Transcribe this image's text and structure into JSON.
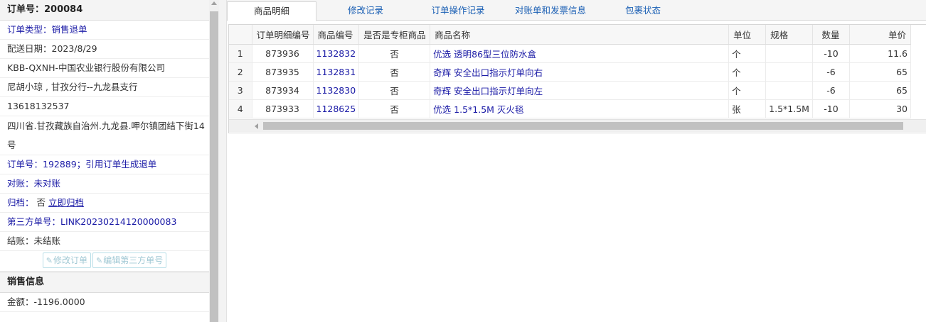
{
  "order": {
    "header": "订单号：200084",
    "fields": [
      {
        "text": "订单类型：销售退单",
        "style": "blue"
      },
      {
        "text": "配送日期：2023/8/29",
        "style": "dark"
      },
      {
        "text": "KBB-QXNH-中国农业银行股份有限公司",
        "style": "dark"
      },
      {
        "text": "尼胡小琼 , 甘孜分行--九龙县支行",
        "style": "dark"
      },
      {
        "text": "13618132537",
        "style": "dark"
      }
    ],
    "address": "四川省.甘孜藏族自治州.九龙县.呷尔镇团结下街14号",
    "ref_order": "订单号：192889；引用订单生成退单",
    "reconcile": "对账：未对账",
    "archive_label": "归档：",
    "archive_value": "否",
    "archive_link": "立即归档",
    "third_party": "第三方单号：LINK20230214120000083",
    "settlement": "结账：未结账",
    "buttons": {
      "edit_order": "修改订单",
      "edit_third_party": "编辑第三方单号"
    }
  },
  "sales": {
    "header": "销售信息",
    "amount": "金额：-1196.0000"
  },
  "tabs": [
    {
      "label": "商品明细",
      "active": true
    },
    {
      "label": "修改记录",
      "active": false
    },
    {
      "label": "订单操作记录",
      "active": false
    },
    {
      "label": "对账单和发票信息",
      "active": false
    },
    {
      "label": "包裹状态",
      "active": false
    }
  ],
  "grid": {
    "columns": [
      "",
      "订单明细编号",
      "商品编号",
      "是否是专柜商品",
      "商品名称",
      "单位",
      "规格",
      "数量",
      "单价"
    ],
    "rows": [
      {
        "n": "1",
        "detail_id": "873936",
        "product_id": "1132832",
        "counter": "否",
        "name": "优选 透明86型三位防水盒",
        "unit": "个",
        "spec": "",
        "qty": "-10",
        "price": "11.6"
      },
      {
        "n": "2",
        "detail_id": "873935",
        "product_id": "1132831",
        "counter": "否",
        "name": "奇辉 安全出口指示灯单向右",
        "unit": "个",
        "spec": "",
        "qty": "-6",
        "price": "65"
      },
      {
        "n": "3",
        "detail_id": "873934",
        "product_id": "1132830",
        "counter": "否",
        "name": "奇辉 安全出口指示灯单向左",
        "unit": "个",
        "spec": "",
        "qty": "-6",
        "price": "65"
      },
      {
        "n": "4",
        "detail_id": "873933",
        "product_id": "1128625",
        "counter": "否",
        "name": "优选 1.5*1.5M 灭火毯",
        "unit": "张",
        "spec": "1.5*1.5M",
        "qty": "-10",
        "price": "30"
      }
    ]
  },
  "colors": {
    "link_blue": "#1a1aa6",
    "tab_blue": "#1a5fb4",
    "ghost_button": "#a0c8d4"
  }
}
